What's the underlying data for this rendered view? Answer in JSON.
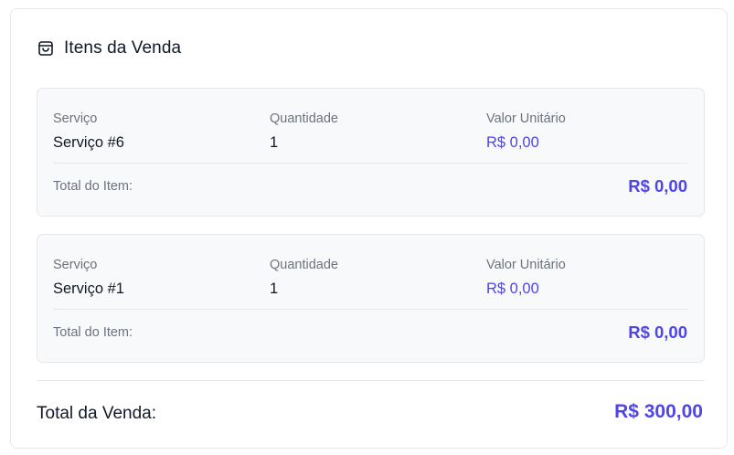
{
  "section": {
    "title": "Itens da Venda",
    "icon": "shopping-bag-icon"
  },
  "labels": {
    "service": "Serviço",
    "quantity": "Quantidade",
    "unit_value": "Valor Unitário",
    "item_total": "Total do Item:"
  },
  "items": [
    {
      "service": "Serviço #6",
      "quantity": "1",
      "unit_value": "R$ 0,00",
      "total": "R$ 0,00"
    },
    {
      "service": "Serviço #1",
      "quantity": "1",
      "unit_value": "R$ 0,00",
      "total": "R$ 0,00"
    }
  ],
  "sale_total": {
    "label": "Total da Venda:",
    "value": "R$ 300,00"
  },
  "colors": {
    "accent": "#4f46e5",
    "muted_text": "#6b7280",
    "card_bg": "#f8f9fb",
    "border": "#e5e7eb"
  }
}
